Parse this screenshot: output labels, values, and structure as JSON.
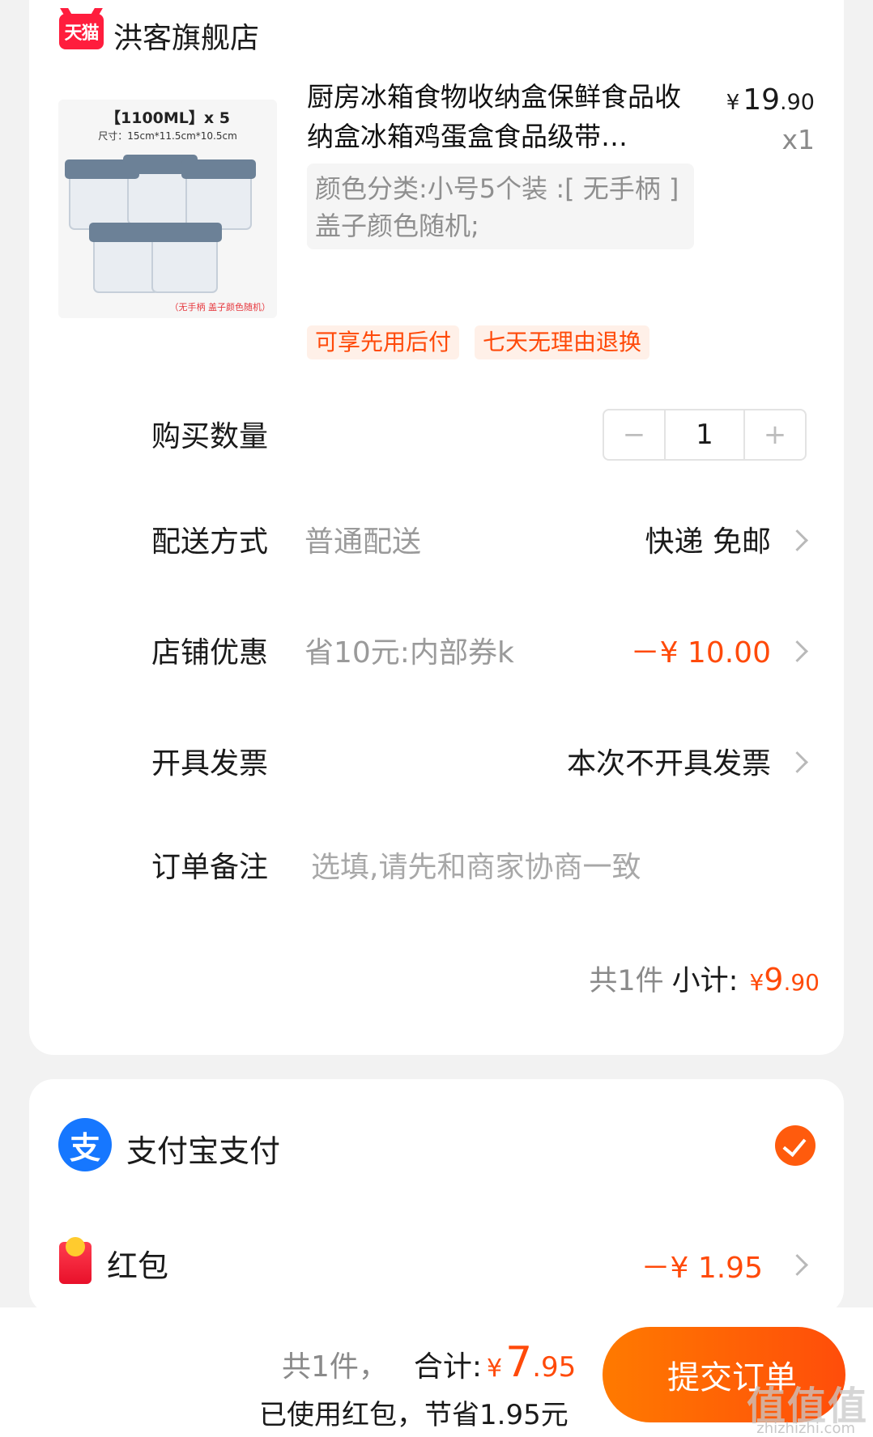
{
  "shop": {
    "logo_text": "天猫",
    "name": "洪客旗舰店"
  },
  "product": {
    "image_title": "【1100ML】x 5",
    "image_size": "尺寸：15cm*11.5cm*10.5cm",
    "image_note": "（无手柄  盖子颜色随机）",
    "title": "厨房冰箱食物收纳盒保鲜食品收纳盒冰箱鸡蛋盒食品级带…",
    "price_currency": "¥",
    "price_int": "19",
    "price_dec": ".90",
    "quantity_x": "x1",
    "spec": "颜色分类:小号5个装 :[ 无手柄 ] 盖子颜色随机;",
    "tags": [
      "可享先用后付",
      "七天无理由退换"
    ]
  },
  "rows": {
    "quantity_label": "购买数量",
    "quantity_value": "1",
    "stepper_minus": "−",
    "stepper_plus": "+",
    "delivery_label": "配送方式",
    "delivery_sub": "普通配送",
    "delivery_value": "快递 免邮",
    "discount_label": "店铺优惠",
    "discount_sub": "省10元:内部券k",
    "discount_value": "－¥ 10.00",
    "invoice_label": "开具发票",
    "invoice_value": "本次不开具发票",
    "note_label": "订单备注",
    "note_placeholder": "选填,请先和商家协商一致"
  },
  "subtotal": {
    "count": "共1件",
    "label": "小计:",
    "currency": "¥",
    "int": "9",
    "dec": ".90"
  },
  "payment": {
    "alipay_icon_text": "支",
    "alipay_label": "支付宝支付",
    "redpacket_label": "红包",
    "redpacket_value": "－¥ 1.95"
  },
  "bottom": {
    "count": "共1件，",
    "total_label": "合计:",
    "currency": "¥",
    "total_int": "7",
    "total_dec": ".95",
    "saved": "已使用红包，节省1.95元",
    "submit_label": "提交订单"
  },
  "watermark": {
    "text": "值值值",
    "sub": "zhizhizhi.com"
  },
  "colors": {
    "accent": "#ff4a0a",
    "tmall_red": "#ff1d3d",
    "alipay_blue": "#1677ff"
  }
}
